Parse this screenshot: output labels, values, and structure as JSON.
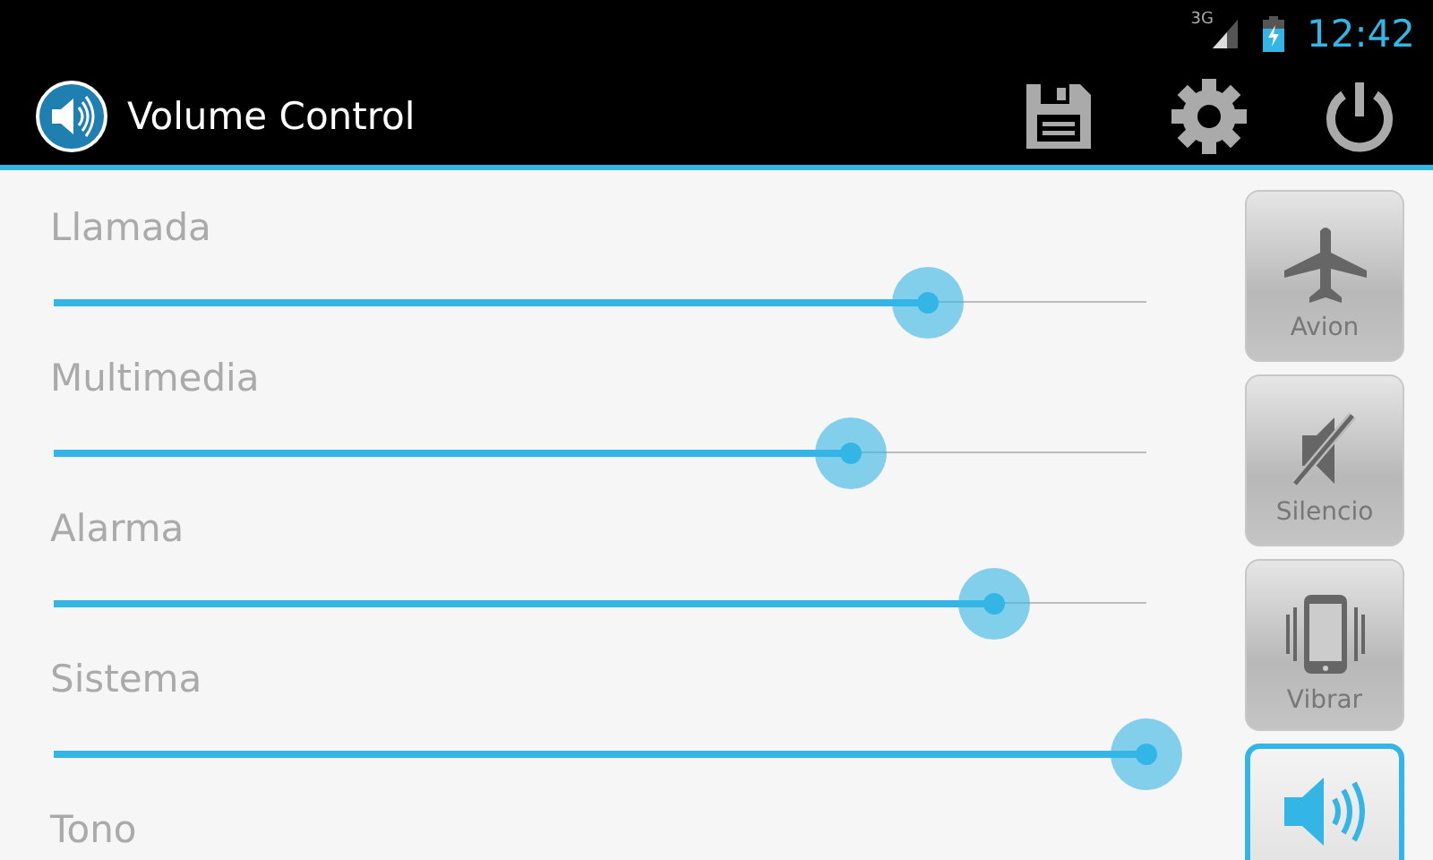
{
  "status_bar": {
    "network": "3G",
    "time": "12:42"
  },
  "action_bar": {
    "title": "Volume Control"
  },
  "channels": [
    {
      "name": "Llamada",
      "level": 0.8
    },
    {
      "name": "Multimedia",
      "level": 0.73
    },
    {
      "name": "Alarma",
      "level": 0.86
    },
    {
      "name": "Sistema",
      "level": 1.0
    },
    {
      "name": "Tono"
    }
  ],
  "modes": [
    {
      "kind": "airplane",
      "label": "Avion",
      "selected": false
    },
    {
      "kind": "silent",
      "label": "Silencio",
      "selected": false
    },
    {
      "kind": "vibrate",
      "label": "Vibrar",
      "selected": false
    },
    {
      "kind": "sound",
      "selected": true
    }
  ]
}
